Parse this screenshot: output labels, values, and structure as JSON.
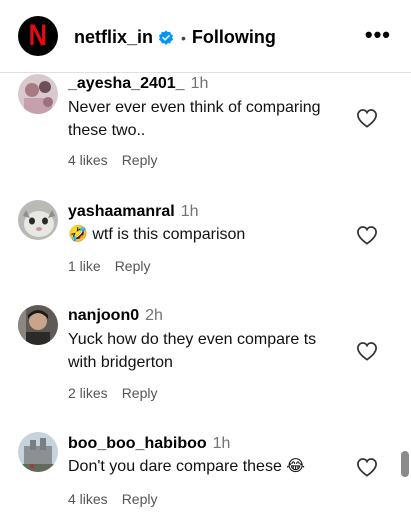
{
  "header": {
    "username": "netflix_in",
    "separator": "•",
    "follow_status": "Following",
    "more_label": "•••",
    "logo_letter": "N"
  },
  "comments": [
    {
      "username": "_ayesha_2401_",
      "time": "1h",
      "text": "Never ever even think of comparing these two..",
      "likes": "4 likes",
      "reply": "Reply"
    },
    {
      "username": "yashaamanral",
      "time": "1h",
      "emoji": "🤣",
      "text": "wtf is this comparison",
      "likes": "1 like",
      "reply": "Reply"
    },
    {
      "username": "nanjoon0",
      "time": "2h",
      "text": "Yuck how do they even compare ts with bridgerton",
      "likes": "2 likes",
      "reply": "Reply"
    },
    {
      "username": "boo_boo_habiboo",
      "time": "1h",
      "text": "Don't you dare compare these",
      "emoji": "😂",
      "likes": "4 likes",
      "reply": "Reply"
    }
  ],
  "colors": {
    "netflix_red": "#e50914",
    "verified_blue": "#0095f6",
    "meta_gray": "#737373"
  }
}
